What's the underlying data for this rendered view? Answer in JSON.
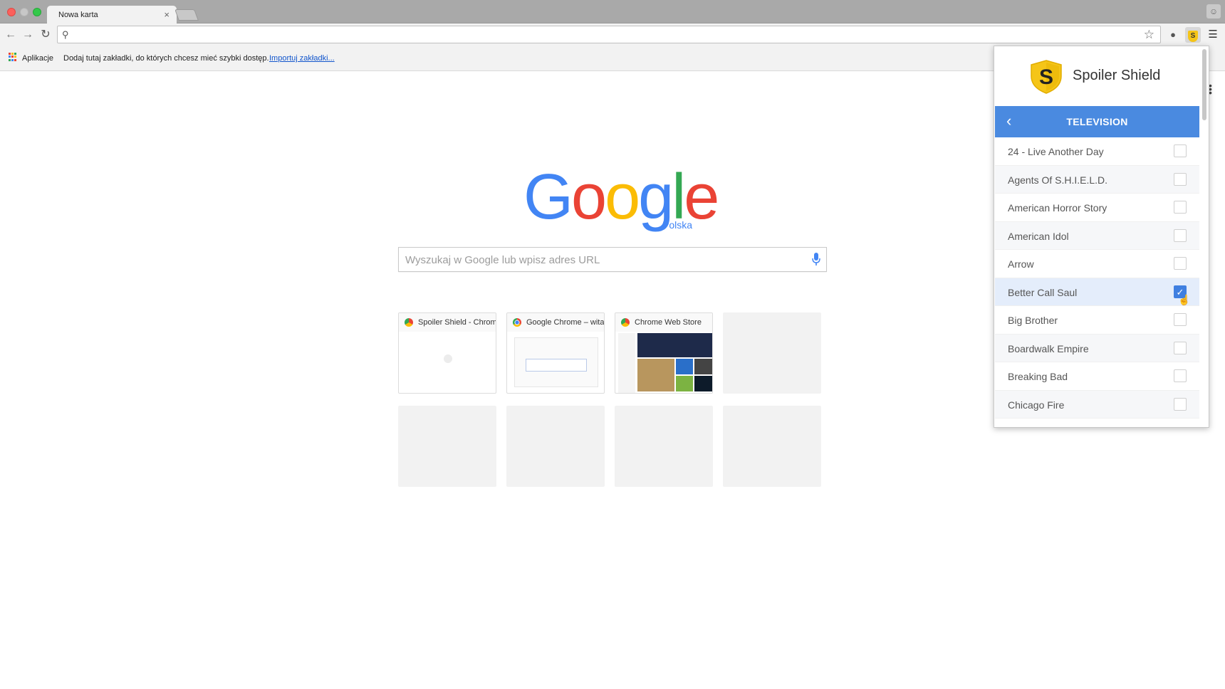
{
  "browser": {
    "tab_title": "Nowa karta",
    "tab_close": "×",
    "omnibox_value": ""
  },
  "bookmarks_bar": {
    "apps_label": "Aplikacje",
    "hint": "Dodaj tutaj zakładki, do których chcesz mieć szybki dostęp.",
    "import_link": "Importuj zakładki..."
  },
  "new_tab": {
    "logo_text": "Google",
    "logo_sub": "Polska",
    "search_placeholder": "Wyszukaj w Google lub wpisz adres URL",
    "tiles": [
      {
        "title": "Spoiler Shield - Chrome Web Store"
      },
      {
        "title": "Google Chrome – witamy"
      },
      {
        "title": "Chrome Web Store"
      }
    ]
  },
  "extension_popup": {
    "title": "Spoiler Shield",
    "shield_letter": "S",
    "category": "TELEVISION",
    "back_icon": "‹",
    "shows": [
      {
        "name": "24 - Live Another Day",
        "checked": false
      },
      {
        "name": "Agents Of S.H.I.E.L.D.",
        "checked": false
      },
      {
        "name": "American Horror Story",
        "checked": false
      },
      {
        "name": "American Idol",
        "checked": false
      },
      {
        "name": "Arrow",
        "checked": false
      },
      {
        "name": "Better Call Saul",
        "checked": true
      },
      {
        "name": "Big Brother",
        "checked": false
      },
      {
        "name": "Boardwalk Empire",
        "checked": false
      },
      {
        "name": "Breaking Bad",
        "checked": false
      },
      {
        "name": "Chicago Fire",
        "checked": false
      }
    ]
  },
  "colors": {
    "popup_accent": "#4a8ae0",
    "shield_yellow": "#f5c518",
    "google_blue": "#4285f4",
    "google_red": "#ea4335",
    "google_yellow": "#fbbc05",
    "google_green": "#34a853"
  },
  "icons": {
    "back": "arrow-left-icon",
    "forward": "arrow-right-icon",
    "reload": "reload-icon",
    "search": "search-icon",
    "star": "star-icon",
    "menu": "hamburger-menu-icon",
    "apps": "apps-grid-icon",
    "mic": "microphone-icon",
    "check": "check-icon",
    "cursor": "hand-cursor-icon"
  }
}
